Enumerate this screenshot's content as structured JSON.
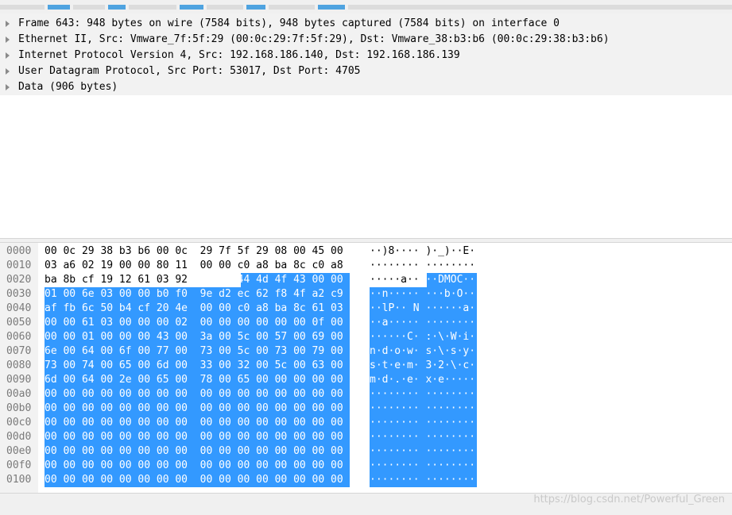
{
  "packet_details": [
    "Frame 643: 948 bytes on wire (7584 bits), 948 bytes captured (7584 bits) on interface 0",
    "Ethernet II, Src: Vmware_7f:5f:29 (00:0c:29:7f:5f:29), Dst: Vmware_38:b3:b6 (00:0c:29:38:b3:b6)",
    "Internet Protocol Version 4, Src: 192.168.186.140, Dst: 192.168.186.139",
    "User Datagram Protocol, Src Port: 53017, Dst Port: 4705",
    "Data (906 bytes)"
  ],
  "hex_rows": [
    {
      "offset": "0000",
      "hex1": "00 0c 29 38 b3 b6 00 0c",
      "hex2": "29 7f 5f 29 08 00 45 00",
      "ascii1": "··)8····",
      "ascii2": ")·_)··E·"
    },
    {
      "offset": "0010",
      "hex1": "03 a6 02 19 00 00 80 11",
      "hex2": "00 00 c0 a8 ba 8c c0 a8",
      "ascii1": "········",
      "ascii2": "········"
    },
    {
      "offset": "0020",
      "hex1": "ba 8b cf 19 12 61 03 92",
      "hex2": "fa 0c 44 4d 4f 43 00 00",
      "ascii1": "·····a··",
      "ascii2": "··DMOC··"
    },
    {
      "offset": "0030",
      "hex1": "01 00 6e 03 00 00 b0 f0",
      "hex2": "9e d2 ec 62 f8 4f a2 c9",
      "ascii1": "··n·····",
      "ascii2": "···b·O··"
    },
    {
      "offset": "0040",
      "hex1": "af fb 6c 50 b4 cf 20 4e",
      "hex2": "00 00 c0 a8 ba 8c 61 03",
      "ascii1": "··lP·· N",
      "ascii2": "······a·"
    },
    {
      "offset": "0050",
      "hex1": "00 00 61 03 00 00 00 02",
      "hex2": "00 00 00 00 00 00 0f 00",
      "ascii1": "··a·····",
      "ascii2": "········"
    },
    {
      "offset": "0060",
      "hex1": "00 00 01 00 00 00 43 00",
      "hex2": "3a 00 5c 00 57 00 69 00",
      "ascii1": "······C·",
      "ascii2": ":·\\·W·i·"
    },
    {
      "offset": "0070",
      "hex1": "6e 00 64 00 6f 00 77 00",
      "hex2": "73 00 5c 00 73 00 79 00",
      "ascii1": "n·d·o·w·",
      "ascii2": "s·\\·s·y·"
    },
    {
      "offset": "0080",
      "hex1": "73 00 74 00 65 00 6d 00",
      "hex2": "33 00 32 00 5c 00 63 00",
      "ascii1": "s·t·e·m·",
      "ascii2": "3·2·\\·c·"
    },
    {
      "offset": "0090",
      "hex1": "6d 00 64 00 2e 00 65 00",
      "hex2": "78 00 65 00 00 00 00 00",
      "ascii1": "m·d·.·e·",
      "ascii2": "x·e·····"
    },
    {
      "offset": "00a0",
      "hex1": "00 00 00 00 00 00 00 00",
      "hex2": "00 00 00 00 00 00 00 00",
      "ascii1": "········",
      "ascii2": "········"
    },
    {
      "offset": "00b0",
      "hex1": "00 00 00 00 00 00 00 00",
      "hex2": "00 00 00 00 00 00 00 00",
      "ascii1": "········",
      "ascii2": "········"
    },
    {
      "offset": "00c0",
      "hex1": "00 00 00 00 00 00 00 00",
      "hex2": "00 00 00 00 00 00 00 00",
      "ascii1": "········",
      "ascii2": "········"
    },
    {
      "offset": "00d0",
      "hex1": "00 00 00 00 00 00 00 00",
      "hex2": "00 00 00 00 00 00 00 00",
      "ascii1": "········",
      "ascii2": "········"
    },
    {
      "offset": "00e0",
      "hex1": "00 00 00 00 00 00 00 00",
      "hex2": "00 00 00 00 00 00 00 00",
      "ascii1": "········",
      "ascii2": "········"
    },
    {
      "offset": "00f0",
      "hex1": "00 00 00 00 00 00 00 00",
      "hex2": "00 00 00 00 00 00 00 00",
      "ascii1": "········",
      "ascii2": "········"
    },
    {
      "offset": "0100",
      "hex1": "00 00 00 00 00 00 00 00",
      "hex2": "00 00 00 00 00 00 00 00",
      "ascii1": "········",
      "ascii2": "········"
    }
  ],
  "selection_color": "#3399ff",
  "watermark": "https://blog.csdn.net/Powerful_Green"
}
